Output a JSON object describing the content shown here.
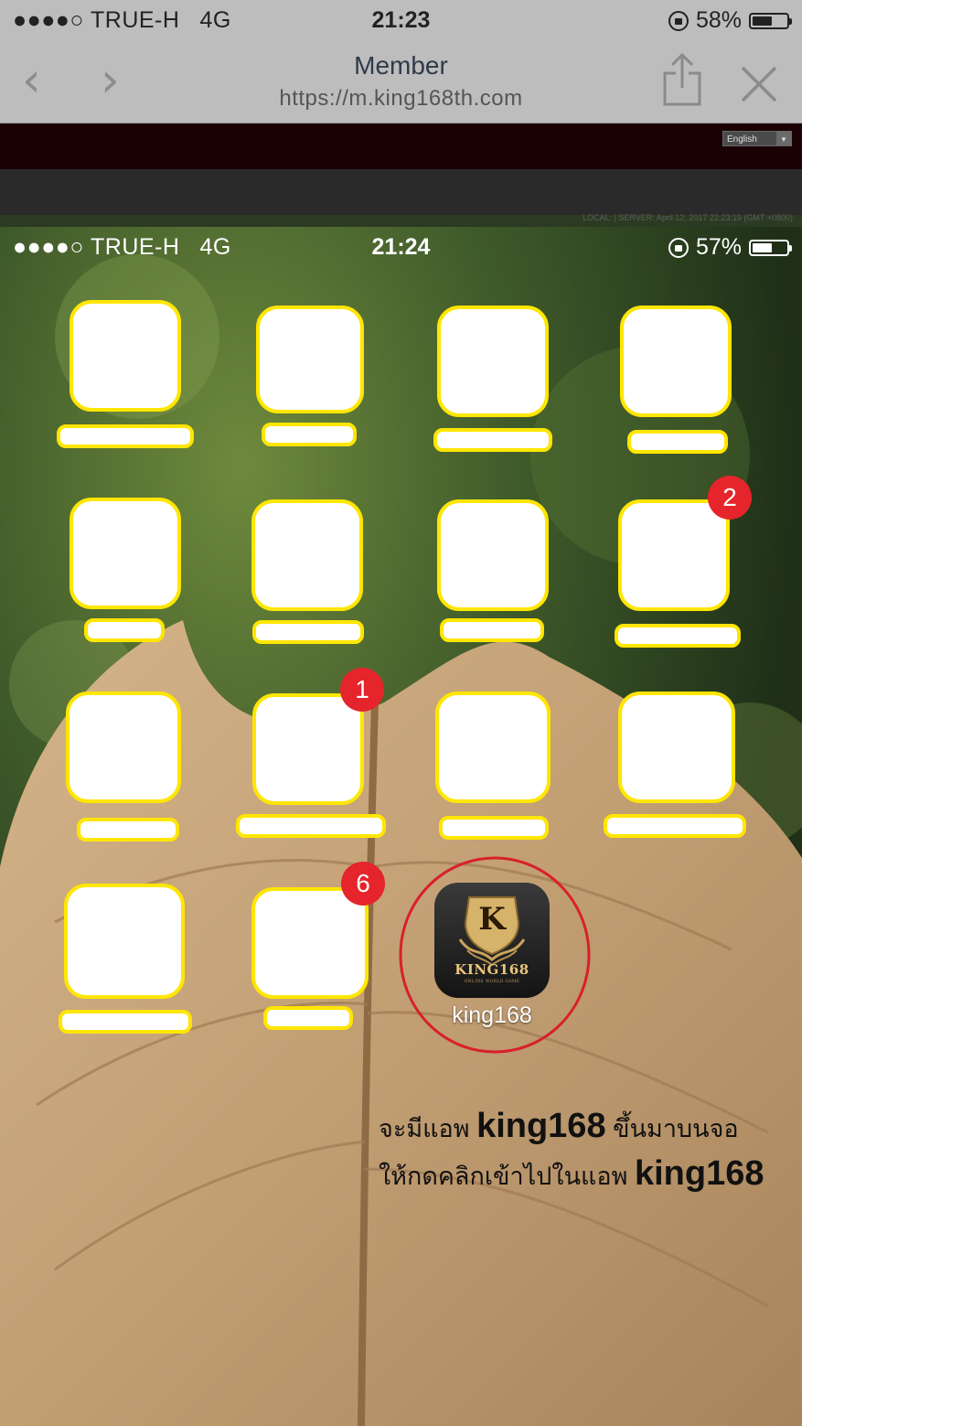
{
  "browser": {
    "status": {
      "carrier": "●●●●○ TRUE-H",
      "network": "4G",
      "time": "21:23",
      "battery": "58%",
      "battery_level": 0.58
    },
    "title": "Member",
    "url": "https://m.king168th.com",
    "back_icon": "chevron-left-icon",
    "forward_icon": "chevron-right-icon",
    "share_icon": "share-icon",
    "close_icon": "close-icon"
  },
  "site": {
    "language": "English",
    "server_time": "LOCAL: | SERVER: April 12, 2017 22:23:19 (GMT +0800)",
    "header_color": "#1a0204"
  },
  "home": {
    "status": {
      "carrier": "●●●●○ TRUE-H",
      "network": "4G",
      "time": "21:24",
      "battery": "57%",
      "battery_level": 0.57
    },
    "badges": {
      "row2_col4": "2",
      "row3_col2": "1",
      "row4_col2": "6"
    },
    "app": {
      "label": "king168",
      "brand": "KING168",
      "brand_sub": "ONLINE WORLD GAME",
      "letter": "K"
    },
    "instruction": {
      "line1_pre": "จะมีแอพ",
      "line1_app": "king168",
      "line1_post": "ขึ้นมาบนจอ",
      "line2_pre": "ให้กดคลิกเข้าไปในแอพ",
      "line2_app": "king168"
    },
    "highlight_color": "#ffe600",
    "circle_color": "#d8202a"
  }
}
